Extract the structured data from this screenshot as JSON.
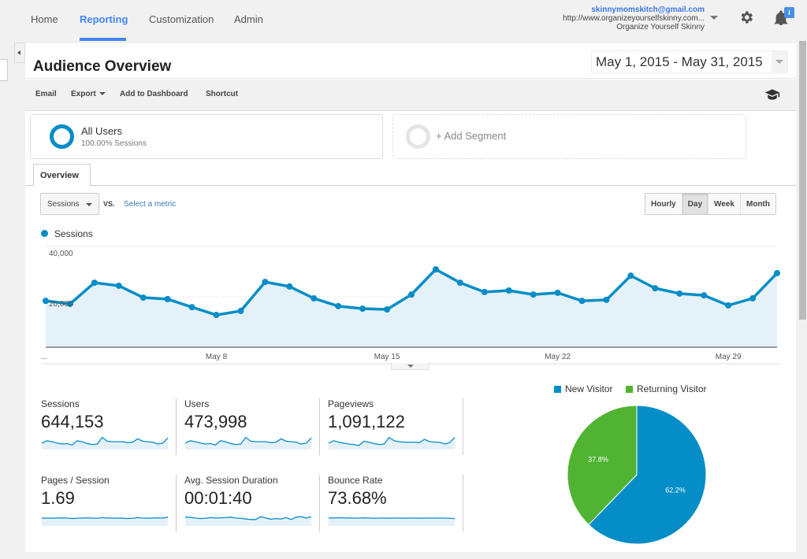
{
  "nav": {
    "tabs": [
      {
        "label": "Home"
      },
      {
        "label": "Reporting",
        "active": true
      },
      {
        "label": "Customization"
      },
      {
        "label": "Admin"
      }
    ],
    "account": {
      "email": "skinnymomskitch@gmail.com",
      "url": "http://www.organizeyourselfskinny.com...",
      "property": "Organize Yourself Skinny"
    },
    "icons": {
      "settings": "gear-icon",
      "notifications": "bell-icon"
    },
    "notification_badge": "i"
  },
  "page": {
    "title": "Audience Overview",
    "date_range": "May 1, 2015 - May 31, 2015"
  },
  "toolbar": {
    "email": "Email",
    "export": "Export",
    "add_to_dashboard": "Add to Dashboard",
    "shortcut": "Shortcut",
    "help_icon": "graduation-cap-icon"
  },
  "segments": {
    "all_users": {
      "name": "All Users",
      "sub": "100.00% Sessions"
    },
    "add_segment": "+ Add Segment"
  },
  "tabs": {
    "overview": "Overview"
  },
  "controls": {
    "metric": "Sessions",
    "vs": "VS.",
    "select_metric": "Select a metric",
    "granularity": [
      {
        "label": "Hourly"
      },
      {
        "label": "Day",
        "active": true
      },
      {
        "label": "Week"
      },
      {
        "label": "Month"
      }
    ]
  },
  "colors": {
    "accent": "#058dc7",
    "nav_active": "#4285f4",
    "area_fill": "#e5f1f9",
    "returning": "#50b432"
  },
  "chart_data": [
    {
      "type": "area",
      "title": "Sessions",
      "legend": [
        "Sessions"
      ],
      "x": [
        "May 1",
        "May 2",
        "May 3",
        "May 4",
        "May 5",
        "May 6",
        "May 7",
        "May 8",
        "May 9",
        "May 10",
        "May 11",
        "May 12",
        "May 13",
        "May 14",
        "May 15",
        "May 16",
        "May 17",
        "May 18",
        "May 19",
        "May 20",
        "May 21",
        "May 22",
        "May 23",
        "May 24",
        "May 25",
        "May 26",
        "May 27",
        "May 28",
        "May 29",
        "May 30",
        "May 31"
      ],
      "series": [
        {
          "name": "Sessions",
          "values": [
            18400,
            17200,
            25600,
            24400,
            19700,
            19100,
            15900,
            12800,
            14400,
            25900,
            24100,
            19400,
            16300,
            15300,
            15000,
            20900,
            30900,
            25600,
            21900,
            22500,
            20900,
            21600,
            18400,
            18800,
            28400,
            23400,
            21300,
            20600,
            16600,
            19400,
            29400
          ]
        }
      ],
      "x_tick_labels": [
        "...",
        "May 8",
        "May 15",
        "May 22",
        "May 29"
      ],
      "y_tick_labels": [
        "20,000",
        "40,000"
      ],
      "ylim": [
        0,
        40000
      ],
      "grid": true
    },
    {
      "type": "pie",
      "legend_position": "top",
      "categories": [
        "New Visitor",
        "Returning Visitor"
      ],
      "values": [
        62.2,
        37.8
      ],
      "labels": [
        "62.2%",
        "37.8%"
      ],
      "colors": [
        "#058dc7",
        "#50b432"
      ]
    }
  ],
  "kpis": [
    {
      "label": "Sessions",
      "value": "644,153",
      "trend": [
        0.35,
        0.6,
        0.5,
        0.35,
        0.25,
        0.3,
        0.15,
        0.6,
        0.5,
        0.3,
        0.2,
        0.25,
        0.95,
        0.55,
        0.5,
        0.5,
        0.5,
        0.4,
        0.45,
        0.8,
        0.55,
        0.5,
        0.45,
        0.25,
        0.35,
        0.9
      ]
    },
    {
      "label": "Users",
      "value": "473,998",
      "trend": [
        0.35,
        0.6,
        0.5,
        0.35,
        0.25,
        0.3,
        0.15,
        0.6,
        0.5,
        0.3,
        0.2,
        0.25,
        0.95,
        0.55,
        0.5,
        0.5,
        0.5,
        0.4,
        0.45,
        0.8,
        0.55,
        0.5,
        0.45,
        0.25,
        0.35,
        0.9
      ]
    },
    {
      "label": "Pageviews",
      "value": "1,091,122",
      "trend": [
        0.35,
        0.6,
        0.45,
        0.35,
        0.25,
        0.2,
        0.1,
        0.55,
        0.45,
        0.3,
        0.2,
        0.25,
        0.95,
        0.6,
        0.5,
        0.45,
        0.45,
        0.45,
        0.4,
        0.75,
        0.5,
        0.45,
        0.45,
        0.25,
        0.4,
        0.95
      ]
    },
    {
      "label": "Pages / Session",
      "value": "1.69",
      "trend": [
        0.5,
        0.5,
        0.48,
        0.5,
        0.52,
        0.5,
        0.45,
        0.48,
        0.5,
        0.52,
        0.5,
        0.48,
        0.55,
        0.5,
        0.5,
        0.48,
        0.5,
        0.45,
        0.48,
        0.55,
        0.5,
        0.48,
        0.5,
        0.52,
        0.5,
        0.6
      ]
    },
    {
      "label": "Avg. Session Duration",
      "value": "00:01:40",
      "trend": [
        0.6,
        0.58,
        0.5,
        0.45,
        0.48,
        0.55,
        0.5,
        0.52,
        0.55,
        0.6,
        0.5,
        0.48,
        0.4,
        0.35,
        0.35,
        0.65,
        0.5,
        0.38,
        0.45,
        0.4,
        0.55,
        0.35,
        0.6,
        0.65,
        0.5,
        0.65
      ]
    },
    {
      "label": "Bounce Rate",
      "value": "73.68%",
      "trend": [
        0.5,
        0.52,
        0.52,
        0.52,
        0.5,
        0.5,
        0.5,
        0.52,
        0.5,
        0.48,
        0.5,
        0.5,
        0.48,
        0.5,
        0.5,
        0.48,
        0.5,
        0.5,
        0.48,
        0.5,
        0.5,
        0.5,
        0.5,
        0.5,
        0.48,
        0.45
      ]
    }
  ]
}
